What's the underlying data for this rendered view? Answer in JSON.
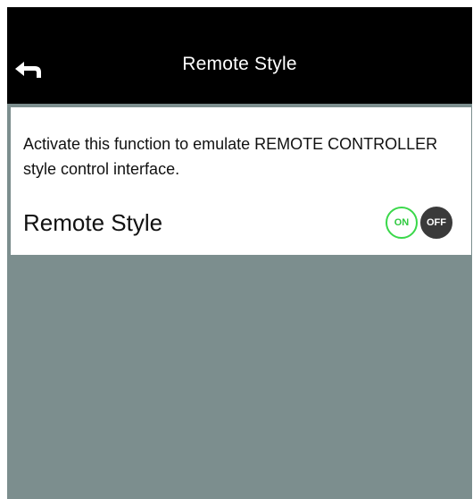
{
  "header": {
    "title": "Remote Style",
    "back_icon": "back-arrow-icon"
  },
  "panel": {
    "description": "Activate this function to emulate REMOTE CONTROLLER style control interface.",
    "setting_label": "Remote Style",
    "toggle": {
      "on_label": "ON",
      "off_label": "OFF",
      "selected": "ON"
    }
  },
  "colors": {
    "header_bg": "#000000",
    "panel_bg": "#ffffff",
    "screen_bg": "#7c8e8e",
    "on_accent": "#3ad84a",
    "off_bg": "#3a3a3a"
  }
}
